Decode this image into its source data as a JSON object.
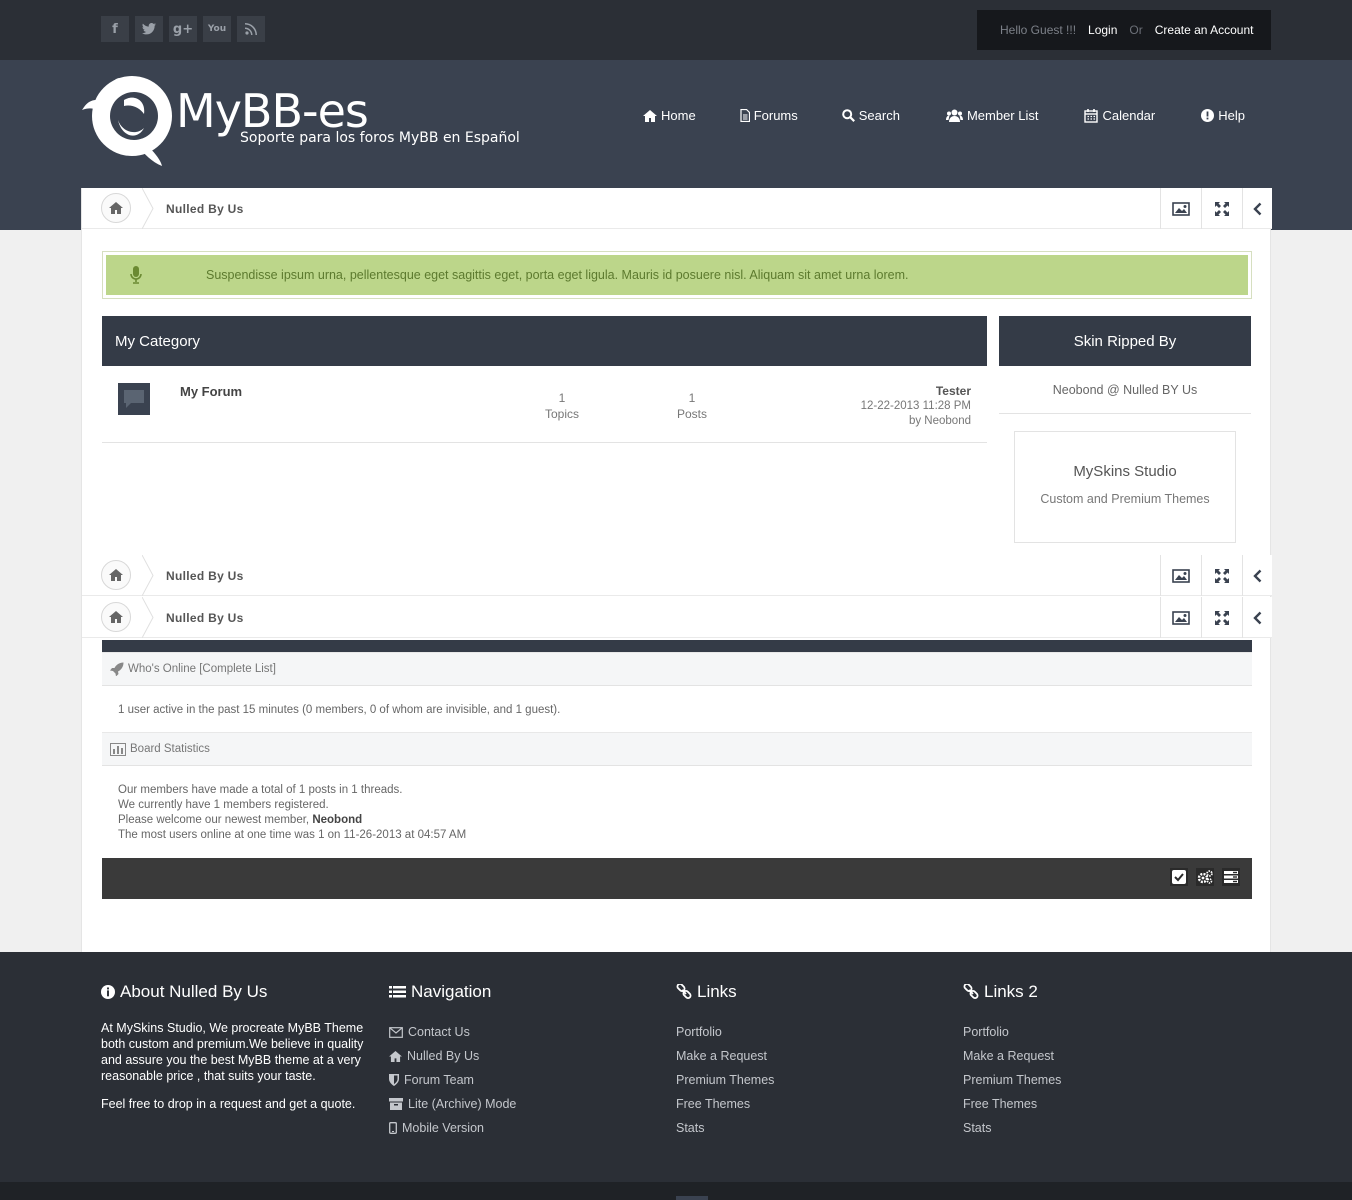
{
  "topbar": {
    "social": [
      {
        "icon": "facebook-icon",
        "glyph": "f"
      },
      {
        "icon": "twitter-icon",
        "glyph": "t"
      },
      {
        "icon": "google-plus-icon",
        "glyph": "g+"
      },
      {
        "icon": "youtube-icon",
        "glyph": "You"
      },
      {
        "icon": "rss-icon",
        "glyph": "rss"
      }
    ],
    "greeting": "Hello Guest !!!",
    "login": "Login",
    "or": "Or",
    "create_account": "Create an Account"
  },
  "logo": {
    "title": "MyBB-es",
    "subtitle": "Soporte para los foros MyBB en Español"
  },
  "nav": [
    {
      "label": "Home",
      "icon": "home-icon"
    },
    {
      "label": "Forums",
      "icon": "document-icon"
    },
    {
      "label": "Search",
      "icon": "search-icon"
    },
    {
      "label": "Member List",
      "icon": "users-icon"
    },
    {
      "label": "Calendar",
      "icon": "calendar-icon"
    },
    {
      "label": "Help",
      "icon": "info-icon"
    }
  ],
  "breadcrumb": {
    "label": "Nulled By Us"
  },
  "notice": "Suspendisse ipsum urna, pellentesque eget sagittis eget, porta eget ligula. Mauris id posuere nisl. Aliquam sit amet urna lorem.",
  "category": {
    "title": "My Category",
    "forum": {
      "name": "My Forum",
      "topics": "1",
      "topics_label": "Topics",
      "posts": "1",
      "posts_label": "Posts",
      "last_post_title": "Tester",
      "last_post_date": "12-22-2013 11:28 PM",
      "last_post_by": "by Neobond"
    }
  },
  "sidebar": {
    "title": "Skin Ripped By",
    "text": "Neobond @ Nulled BY Us",
    "box_title": "MySkins Studio",
    "box_sub": "Custom and Premium Themes"
  },
  "whos_online": {
    "title": "Who's Online [Complete List]",
    "text": "1 user active in the past 15 minutes (0 members, 0 of whom are invisible, and 1 guest)."
  },
  "board_stats": {
    "title": "Board Statistics",
    "line1": "Our members have made a total of 1 posts in 1 threads.",
    "line2": "We currently have 1 members registered.",
    "line3_prefix": "Please welcome our newest member,",
    "newest_member": "Neobond",
    "line4": "The most users online at one time was 1 on 11-26-2013 at 04:57 AM"
  },
  "footer": {
    "about": {
      "title": "About Nulled By Us",
      "p1": "At MySkins Studio, We procreate MyBB Theme both custom and premium.We believe in quality and assure you the best MyBB theme at a very reasonable price , that suits your taste.",
      "p2": "Feel free to drop in a request and get a quote."
    },
    "navigation": {
      "title": "Navigation",
      "items": [
        {
          "label": "Contact Us",
          "icon": "envelope-icon"
        },
        {
          "label": "Nulled By Us",
          "icon": "home-icon"
        },
        {
          "label": "Forum Team",
          "icon": "shield-icon"
        },
        {
          "label": "Lite (Archive) Mode",
          "icon": "archive-icon"
        },
        {
          "label": "Mobile Version",
          "icon": "mobile-icon"
        }
      ]
    },
    "links": {
      "title": "Links",
      "items": [
        "Portfolio",
        "Make a Request",
        "Premium Themes",
        "Free Themes",
        "Stats"
      ]
    },
    "links2": {
      "title": "Links 2",
      "items": [
        "Portfolio",
        "Make a Request",
        "Premium Themes",
        "Free Themes",
        "Stats"
      ]
    }
  },
  "colors": {
    "dark": "#2b2f36",
    "header": "#3a4250",
    "accent": "#343b47",
    "notice_bg": "#bcd68a"
  }
}
